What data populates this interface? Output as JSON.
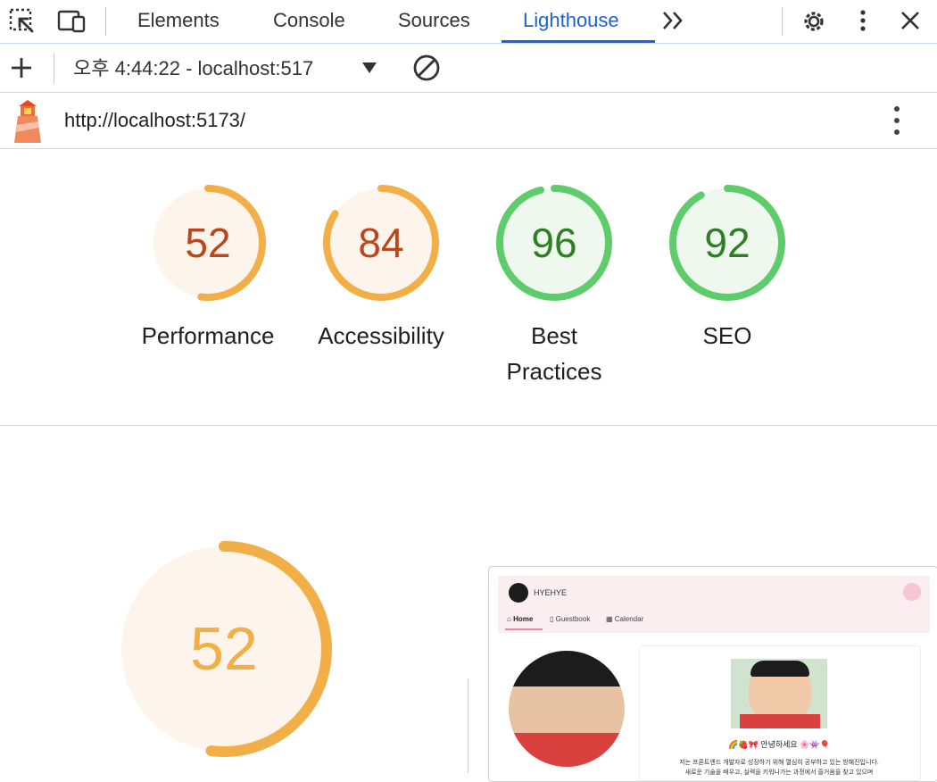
{
  "tabs": [
    {
      "label": "Elements"
    },
    {
      "label": "Console"
    },
    {
      "label": "Sources"
    },
    {
      "label": "Lighthouse"
    }
  ],
  "report": {
    "timestamp_label": "오후 4:44:22 - localhost:517",
    "url": "http://localhost:5173/"
  },
  "categories": [
    {
      "label": "Performance",
      "score": "52",
      "status": "average"
    },
    {
      "label": "Accessibility",
      "score": "84",
      "status": "average"
    },
    {
      "label": "Best",
      "label2": "Practices",
      "score": "96",
      "status": "pass"
    },
    {
      "label": "SEO",
      "score": "92",
      "status": "pass"
    }
  ],
  "gauge_values": [
    0.52,
    0.84,
    0.96,
    0.92
  ],
  "main_gauge": {
    "score": "52",
    "value": 0.52
  },
  "colors": {
    "average_stroke": "#f2ae47",
    "average_fill": "#fdf5eb",
    "average_text": "#b9461c",
    "pass_stroke": "#5fcc6b",
    "pass_fill": "#eef8ef",
    "pass_text": "#2f7f24",
    "accent": "#1a63d6"
  },
  "preview": {
    "site_name": "HYEHYE",
    "nav": [
      {
        "label": "Home"
      },
      {
        "label": "Guestbook"
      },
      {
        "label": "Calendar"
      }
    ],
    "greeting": "🌈🍓🎀 안녕하세요 🌸👾🎈",
    "line1": "저는 프론트엔드 개발자로 성장하기 위해 열심히 공부하고 있는 방혜진입니다.",
    "line2": "새로운 기술을 배우고, 실력을 키워나가는 과정에서 즐거움을 찾고 있으며"
  }
}
